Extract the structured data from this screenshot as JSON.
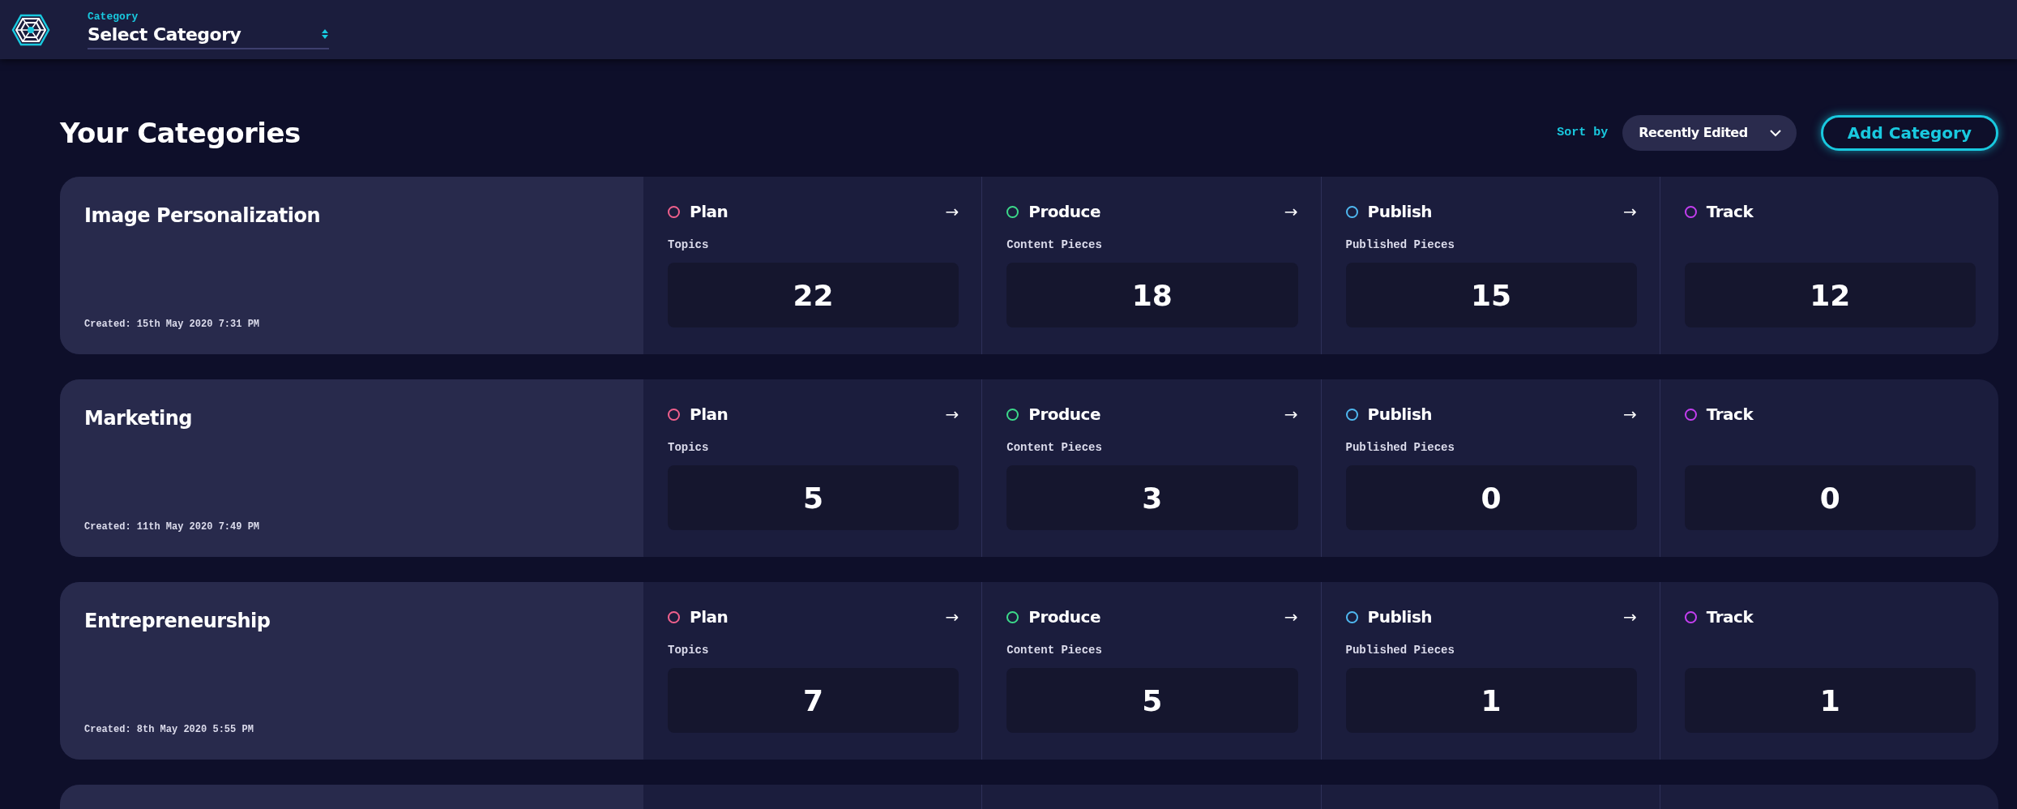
{
  "header": {
    "field_label": "Category",
    "select_value": "Select Category"
  },
  "page_title": "Your Categories",
  "sort": {
    "label": "Sort by",
    "value": "Recently Edited"
  },
  "add_button": "Add Category",
  "categories": [
    {
      "name": "Image Personalization",
      "created": "Created: 15th May 2020 7:31 PM",
      "stages": [
        {
          "name": "Plan",
          "color": "#f0608c",
          "arrow": "→",
          "metric": "Topics",
          "value": "22"
        },
        {
          "name": "Produce",
          "color": "#3cd98a",
          "arrow": "→",
          "metric": "Content Pieces",
          "value": "18"
        },
        {
          "name": "Publish",
          "color": "#4fb8f0",
          "arrow": "→",
          "metric": "Published Pieces",
          "value": "15"
        },
        {
          "name": "Track",
          "color": "#c43ef0",
          "value": "12"
        }
      ]
    },
    {
      "name": "Marketing",
      "created": "Created: 11th May 2020 7:49 PM",
      "stages": [
        {
          "name": "Plan",
          "color": "#f0608c",
          "arrow": "→",
          "metric": "Topics",
          "value": "5"
        },
        {
          "name": "Produce",
          "color": "#3cd98a",
          "arrow": "→",
          "metric": "Content Pieces",
          "value": "3"
        },
        {
          "name": "Publish",
          "color": "#4fb8f0",
          "arrow": "→",
          "metric": "Published Pieces",
          "value": "0"
        },
        {
          "name": "Track",
          "color": "#c43ef0",
          "value": "0"
        }
      ]
    },
    {
      "name": "Entrepreneurship",
      "created": "Created: 8th May 2020 5:55 PM",
      "stages": [
        {
          "name": "Plan",
          "color": "#f0608c",
          "arrow": "→",
          "metric": "Topics",
          "value": "7"
        },
        {
          "name": "Produce",
          "color": "#3cd98a",
          "arrow": "→",
          "metric": "Content Pieces",
          "value": "5"
        },
        {
          "name": "Publish",
          "color": "#4fb8f0",
          "arrow": "→",
          "metric": "Published Pieces",
          "value": "1"
        },
        {
          "name": "Track",
          "color": "#c43ef0",
          "value": "1"
        }
      ]
    }
  ]
}
